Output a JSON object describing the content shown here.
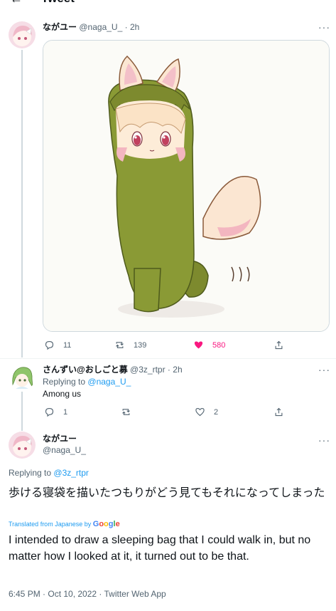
{
  "header": {
    "back_icon": "arrow-left-icon",
    "title": "Tweet"
  },
  "main_tweet": {
    "display_name": "ながユー",
    "handle": "@naga_U_",
    "separator": "·",
    "time": "2h",
    "media_description_icon": "illustration-image",
    "actions": {
      "reply_count": "11",
      "retweet_count": "139",
      "like_count": "580",
      "like_color": "#f91880"
    }
  },
  "reply_tweet": {
    "display_name": "さんずい@おしごと募",
    "handle": "@3z_rtpr",
    "separator": "·",
    "time": "2h",
    "replying_prefix": "Replying to",
    "replying_handle": "@naga_U_",
    "text": "Among us",
    "actions": {
      "reply_count": "1",
      "retweet_count": "",
      "like_count": "2"
    }
  },
  "focused_tweet": {
    "display_name": "ながユー",
    "handle": "@naga_U_",
    "replying_prefix": "Replying to",
    "replying_handle": "@3z_rtpr",
    "text_original": "歩ける寝袋を描いたつもりがどう見てもそれになってしまった",
    "translated_from": "Translated from Japanese by",
    "translator": "Google",
    "text_translated": "I intended to draw a sleeping bag that I could walk in, but no matter how I looked at it, it turned out to be that.",
    "timestamp": "6:45 PM · Oct 10, 2022 · Twitter Web App"
  },
  "colors": {
    "accent": "#1d9bf0",
    "like": "#f91880",
    "text": "#0f1419",
    "secondary_text": "#536471",
    "border": "#cfd9de"
  }
}
